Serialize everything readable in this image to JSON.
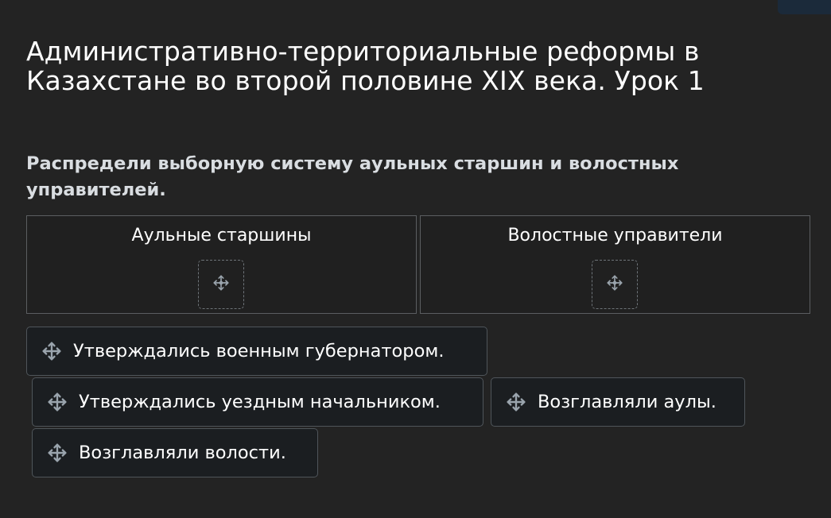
{
  "page": {
    "title": "Административно-территориальные реформы в Казахстане во второй половине XIX века. Урок 1"
  },
  "question": {
    "text": "Распредели выборную систему аульных старшин и волостных управителей."
  },
  "drop_zones": [
    {
      "label": "Аульные старшины",
      "icon": "move-arrows-icon"
    },
    {
      "label": "Волостные управители",
      "icon": "move-arrows-icon"
    }
  ],
  "cards": [
    {
      "label": "Утверждались военным губернатором.",
      "icon": "move-arrows-icon"
    },
    {
      "label": "Утверждались уездным начальником.",
      "icon": "move-arrows-icon"
    },
    {
      "label": "Возглавляли аулы.",
      "icon": "move-arrows-icon"
    },
    {
      "label": "Возглавляли волости.",
      "icon": "move-arrows-icon"
    }
  ],
  "colors": {
    "background": "#232323",
    "card_background": "#1b1e21",
    "card_border": "#4f555a",
    "zone_border": "#5b5e61",
    "icon": "#9aa4ad",
    "question_text": "#d9dde1"
  }
}
